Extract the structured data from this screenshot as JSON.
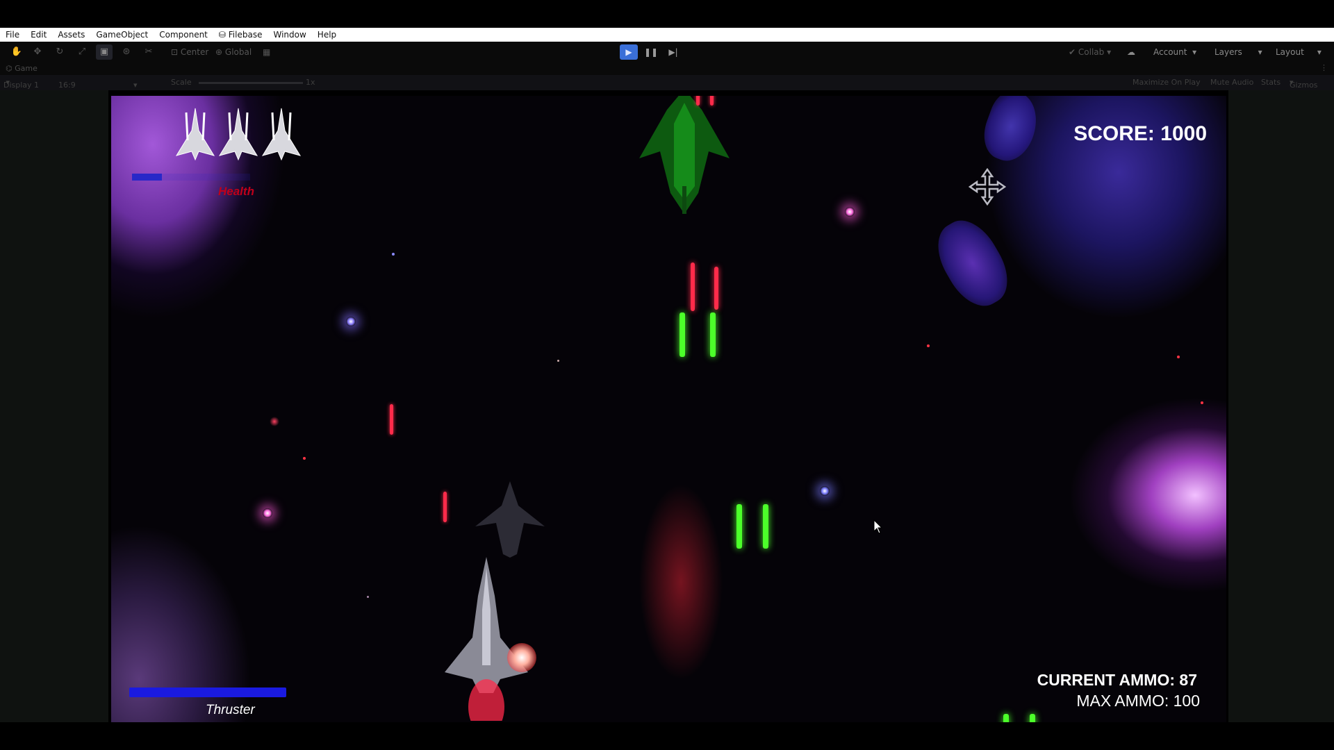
{
  "menu": {
    "items": [
      "File",
      "Edit",
      "Assets",
      "GameObject",
      "Component",
      "Filebase",
      "Window",
      "Help"
    ]
  },
  "toolbar": {
    "tools": [
      "hand-icon",
      "move-icon",
      "rotate-icon",
      "scale-icon",
      "rect-icon",
      "transform-icon",
      "custom-tool-icon"
    ],
    "pivot_label": "Center",
    "space_label": "Global",
    "collab_label": "Collab",
    "account_label": "Account",
    "layers_label": "Layers",
    "layout_label": "Layout",
    "accent": "#3a6fd8"
  },
  "tab": {
    "title": "Game"
  },
  "game_view": {
    "display_label": "Display 1",
    "aspect_label": "16:9",
    "scale_label": "Scale",
    "scale_value": "1x",
    "maximize_label": "Maximize On Play",
    "mute_label": "Mute Audio",
    "stats_label": "Stats",
    "gizmos_label": "Gizmos"
  },
  "hud": {
    "score": "SCORE: 1000",
    "health_label": "Health",
    "lives": 3,
    "current_ammo": "CURRENT AMMO: 87",
    "max_ammo": "MAX AMMO: 100",
    "thruster_label": "Thruster",
    "thruster_level": 1.0,
    "health_level": 0.25
  },
  "colors": {
    "laser_red": "#ff2b4a",
    "laser_green": "#4cff2a",
    "health_bar": "#2828c8",
    "thruster_bar": "#1a1ae0",
    "health_text": "#c0001a"
  }
}
